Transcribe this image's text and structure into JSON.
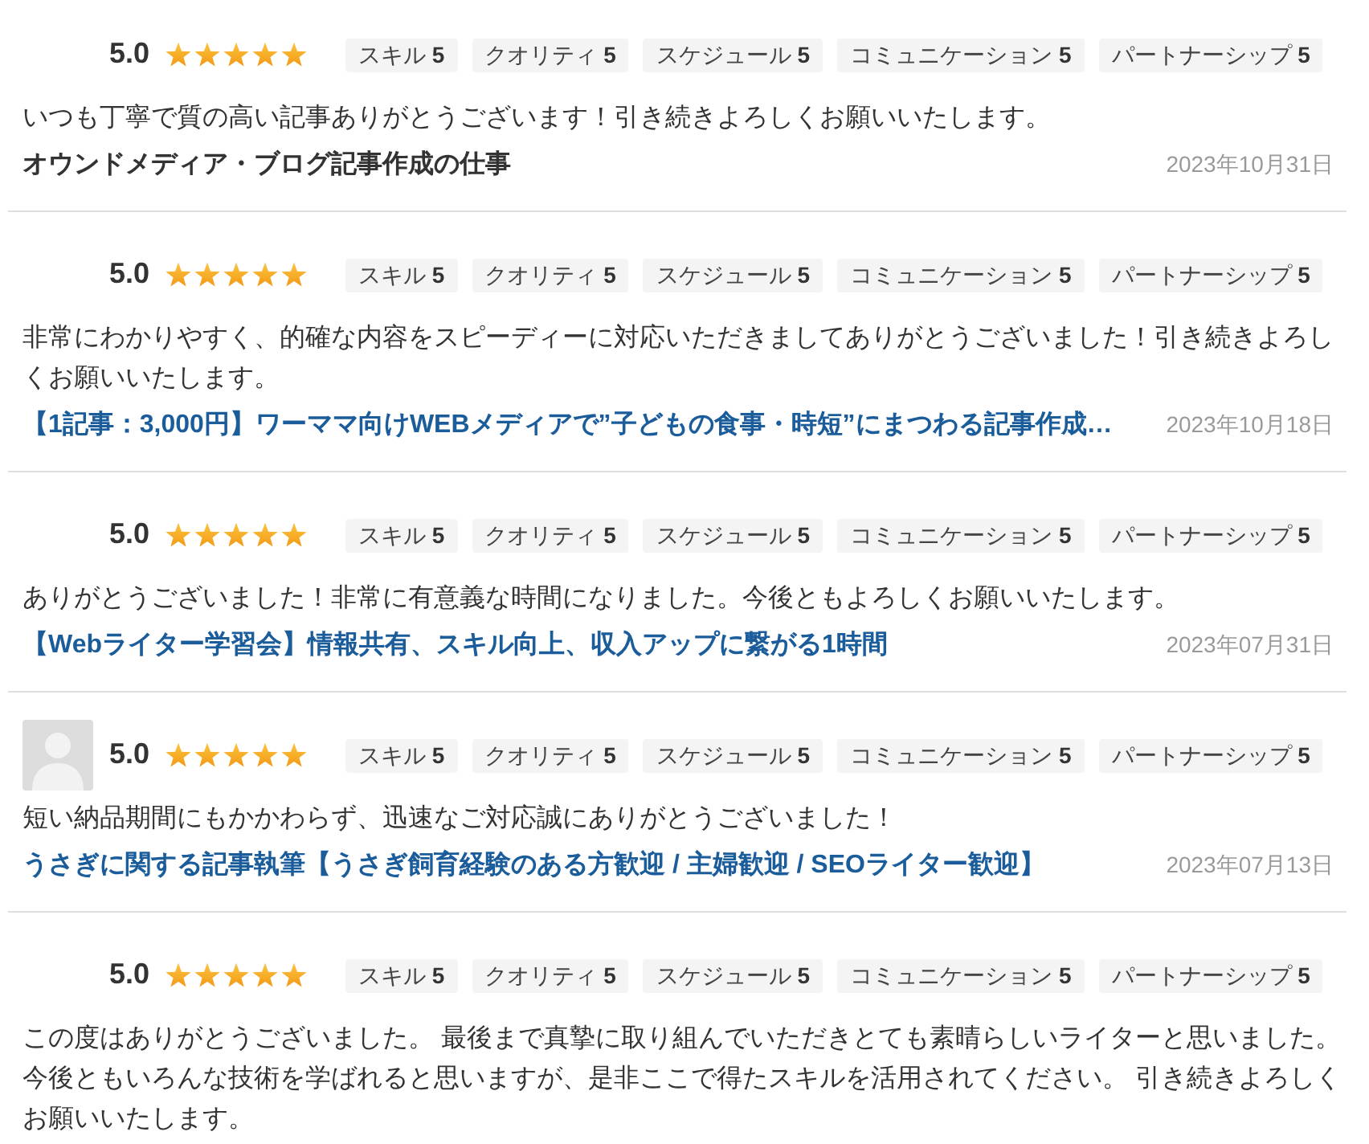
{
  "reviews": [
    {
      "has_avatar": false,
      "score": "5.0",
      "stars": 5,
      "ratings": [
        {
          "label": "スキル",
          "value": "5"
        },
        {
          "label": "クオリティ",
          "value": "5"
        },
        {
          "label": "スケジュール",
          "value": "5"
        },
        {
          "label": "コミュニケーション",
          "value": "5"
        },
        {
          "label": "パートナーシップ",
          "value": "5"
        }
      ],
      "comment": "いつも丁寧で質の高い記事ありがとうございます！引き続きよろしくお願いいたします。",
      "job": {
        "title": "オウンドメディア・ブログ記事作成の仕事",
        "linked": false
      },
      "date": "2023年10月31日"
    },
    {
      "has_avatar": false,
      "score": "5.0",
      "stars": 5,
      "ratings": [
        {
          "label": "スキル",
          "value": "5"
        },
        {
          "label": "クオリティ",
          "value": "5"
        },
        {
          "label": "スケジュール",
          "value": "5"
        },
        {
          "label": "コミュニケーション",
          "value": "5"
        },
        {
          "label": "パートナーシップ",
          "value": "5"
        }
      ],
      "comment": "非常にわかりやすく、的確な内容をスピーディーに対応いただきましてありがとうございました！引き続きよろしくお願いいたします。",
      "job": {
        "title": "【1記事：3,000円】ワーママ向けWEBメディアで”子どもの食事・時短”にまつわる記事作成…",
        "linked": true
      },
      "date": "2023年10月18日"
    },
    {
      "has_avatar": false,
      "score": "5.0",
      "stars": 5,
      "ratings": [
        {
          "label": "スキル",
          "value": "5"
        },
        {
          "label": "クオリティ",
          "value": "5"
        },
        {
          "label": "スケジュール",
          "value": "5"
        },
        {
          "label": "コミュニケーション",
          "value": "5"
        },
        {
          "label": "パートナーシップ",
          "value": "5"
        }
      ],
      "comment": "ありがとうございました！非常に有意義な時間になりました。今後ともよろしくお願いいたします。",
      "job": {
        "title": "【Webライター学習会】情報共有、スキル向上、収入アップに繋がる1時間",
        "linked": true
      },
      "date": "2023年07月31日"
    },
    {
      "has_avatar": true,
      "score": "5.0",
      "stars": 5,
      "ratings": [
        {
          "label": "スキル",
          "value": "5"
        },
        {
          "label": "クオリティ",
          "value": "5"
        },
        {
          "label": "スケジュール",
          "value": "5"
        },
        {
          "label": "コミュニケーション",
          "value": "5"
        },
        {
          "label": "パートナーシップ",
          "value": "5"
        }
      ],
      "comment": "短い納品期間にもかかわらず、迅速なご対応誠にありがとうございました！",
      "job": {
        "title": "うさぎに関する記事執筆【うさぎ飼育経験のある方歓迎 / 主婦歓迎 / SEOライター歓迎】",
        "linked": true
      },
      "date": "2023年07月13日"
    },
    {
      "has_avatar": false,
      "score": "5.0",
      "stars": 5,
      "ratings": [
        {
          "label": "スキル",
          "value": "5"
        },
        {
          "label": "クオリティ",
          "value": "5"
        },
        {
          "label": "スケジュール",
          "value": "5"
        },
        {
          "label": "コミュニケーション",
          "value": "5"
        },
        {
          "label": "パートナーシップ",
          "value": "5"
        }
      ],
      "comment": "この度はありがとうございました。 最後まで真摯に取り組んでいただきとても素晴らしいライターと思いました。今後ともいろんな技術を学ばれると思いますが、是非ここで得たスキルを活用されてください。 引き続きよろしくお願いいたします。"
    }
  ]
}
